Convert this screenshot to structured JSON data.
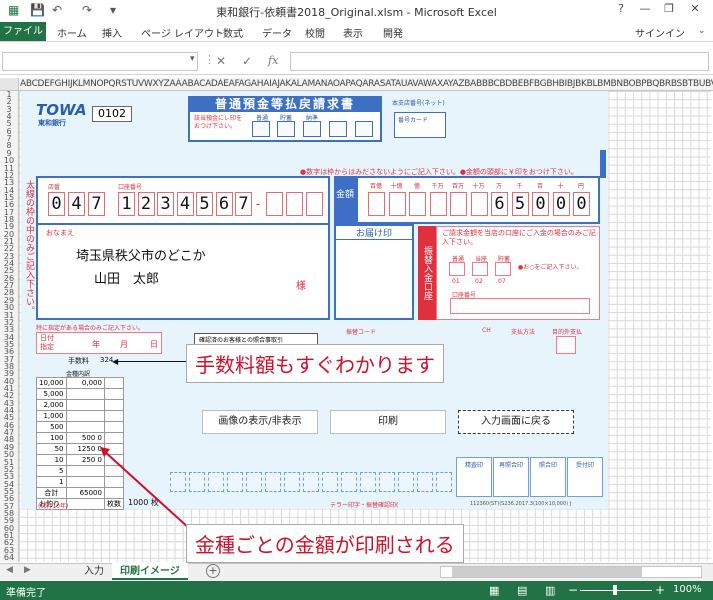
{
  "window": {
    "title": "東和銀行-依頼書2018_Original.xlsm - Microsoft Excel",
    "help": "?",
    "minimize": "—",
    "restore": "❐",
    "close": "✕"
  },
  "ribbon": {
    "file": "ファイル",
    "tabs": [
      "ホーム",
      "挿入",
      "ページ レイアウト",
      "数式",
      "データ",
      "校閲",
      "表示",
      "開発"
    ],
    "signin": "サインイン"
  },
  "formula_bar": {
    "cancel": "✕",
    "enter": "✓",
    "fx": "fx",
    "value": ""
  },
  "columns": "ABCDEFGHIJKLMNOPQRSTUVWXYZAAABACADAEAFAGAHAIAJAKALAMANAOAPAQARASATAUAVAWAXAYAZBABBBCBDBEBFBGBHBIBJBKBLBMBNBOBPBQBRBSBTBUBVBWBXBYBZCACBCCCDCE",
  "form": {
    "bank_logo": "TOWA",
    "bank_name": "東和銀行",
    "form_no": "0102",
    "heading": "普通預金等払戻請求書",
    "check_note": "該当預金にレ印をおつけ下さい。",
    "acct_types": [
      "普通",
      "貯蓄",
      "納準"
    ],
    "branch_label": "本支店番号(ネット)",
    "card_label": "番号カード",
    "notice": "●数字は枠からはみださないようにご記入下さい。●金額の頭部に￥印をおつけ下さい。",
    "side_label": "太線の枠の中のみご記入下さい。",
    "store_label": "店番",
    "acct_label": "口座番号",
    "store_digits": [
      "0",
      "4",
      "7"
    ],
    "acct_digits": [
      "1",
      "2",
      "3",
      "4",
      "5",
      "6",
      "7"
    ],
    "amount_label": "金額",
    "amount_units": [
      "百億",
      "十億",
      "億",
      "千万",
      "百万",
      "十万",
      "万",
      "千",
      "百",
      "十",
      "円"
    ],
    "amount_digits": [
      "6",
      "5",
      "0",
      "0",
      "0"
    ],
    "name_label": "おなまえ",
    "address": "埼玉県秩父市のどこか",
    "name": "山田　太郎",
    "sama": "様",
    "seal_label": "お届け印",
    "transfer_label": "振替入金口座",
    "transfer_note": "ご請求金額を当店の口座にご入金の場合のみご記入下さい。",
    "transfer_types": [
      "普通",
      "当座",
      "貯蓄"
    ],
    "transfer_codes": [
      "01",
      "02",
      "07"
    ],
    "transfer_ck": "●お○をご記入下さい。",
    "transfer_acct": "口座番号",
    "date_note": "特に指定がある場合のみご記入下さい。",
    "date_label": "日付指定",
    "year": "年",
    "month": "月",
    "day": "日",
    "confirm_note": "確認済のお客様との照合事取引",
    "transfer_code_label": "振替コード",
    "ch_label": "CH",
    "method_label": "支払方法",
    "purpose_label": "目的外支払",
    "fee_label": "手数料",
    "fee_value": "324",
    "kin_title": "金種内訳",
    "kin_rows": [
      [
        "10,000",
        "0,000"
      ],
      [
        "5,000",
        ""
      ],
      [
        "2,000",
        ""
      ],
      [
        "1,000",
        ""
      ],
      [
        "500",
        ""
      ],
      [
        "100",
        "500 0"
      ],
      [
        "50",
        "1250 0"
      ],
      [
        "10",
        "250 0"
      ],
      [
        "5",
        ""
      ],
      [
        "1",
        ""
      ]
    ],
    "kin_total_label": "合計",
    "kin_total": "65000",
    "kin_change": "お釣り",
    "kin_sheets": "枚数",
    "extra_count": "1000 枚",
    "stamp_labels": [
      "精査印",
      "再照合印",
      "照合印",
      "受付印"
    ],
    "teller_note": "テラー印字・振替確認印(",
    "retention": "(保存10年)",
    "footer_code": "112360(ST)(S236.2017.3(100×10,000) J"
  },
  "buttons": {
    "toggle_image": "画像の表示/非表示",
    "print": "印刷",
    "back": "入力画面に戻る"
  },
  "callouts": {
    "fee": "手数料額もすぐわかります",
    "denomination": "金種ごとの金額が印刷される"
  },
  "sheets": {
    "tabs": [
      "入力",
      "印刷イメージ"
    ],
    "add": "+"
  },
  "status": {
    "ready": "準備完了",
    "zoom": "100%"
  },
  "colors": {
    "excel_green": "#217346",
    "form_blue": "#3d6fc4",
    "form_red": "#e0303f",
    "callout_red": "#d0102a"
  }
}
